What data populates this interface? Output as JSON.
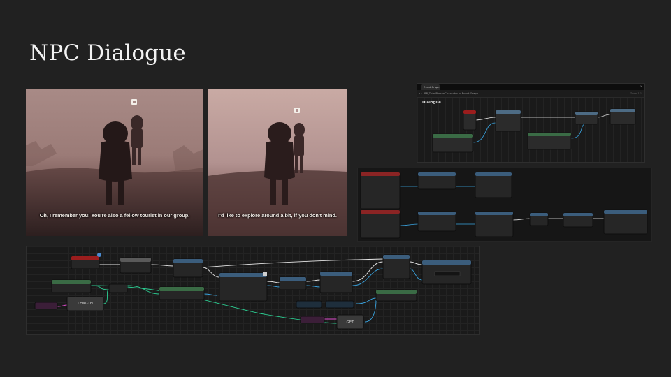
{
  "slide": {
    "title": "NPC Dialogue"
  },
  "screenshots": [
    {
      "subtitle": "Oh, I remember you! You're also a fellow tourist in our group."
    },
    {
      "subtitle": "I'd like to explore around a bit, if you don't mind."
    }
  ],
  "event_graph": {
    "tab_label": "Event Graph",
    "close_glyph": "×",
    "nav_glyph": "◂ ▸",
    "breadcrumb": "BP_ThirdPersonCharacter > Event Graph",
    "zoom": "Zoom 1:1",
    "comment_label": "Dialogue"
  },
  "main_graph": {
    "length_label": "LENGTH",
    "get_label": "GET"
  },
  "colors": {
    "background": "#212121",
    "title": "#f2f2f2",
    "exec_wire": "#e8e8e8",
    "object_wire": "#3aa6e3",
    "int_wire": "#2ccf93",
    "array_wire": "#e24dd1",
    "event_header": "#9b1d1d"
  }
}
